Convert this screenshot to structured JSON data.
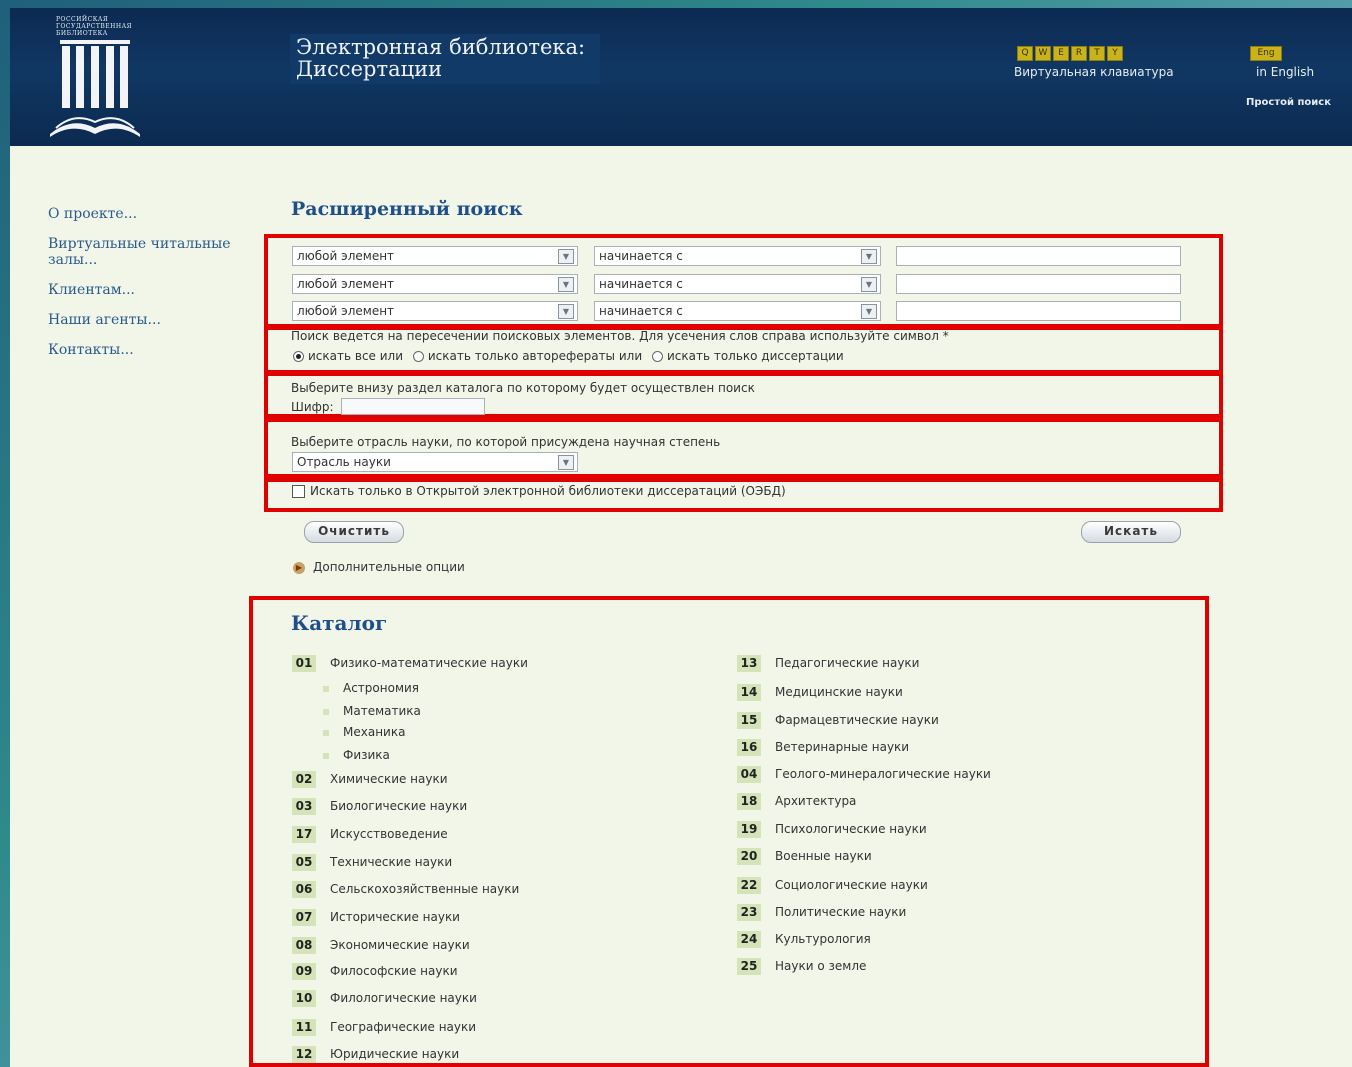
{
  "header": {
    "logo_text": "РОССИЙСКАЯ ГОСУДАРСТВЕННАЯ БИБЛИОТЕКА",
    "title_line1": "Электронная библиотека:",
    "title_line2": "Диссертации",
    "qwerty_keys": [
      "Q",
      "W",
      "E",
      "R",
      "T",
      "Y"
    ],
    "virtual_keyboard": "Виртуальная клавиатура",
    "eng_badge": "Eng",
    "in_english": "in English",
    "simple_search": "Простой поиск"
  },
  "sidebar": {
    "items": [
      {
        "label": "О проекте..."
      },
      {
        "label": "Виртуальные читальные залы..."
      },
      {
        "label": "Клиентам..."
      },
      {
        "label": "Наши агенты..."
      },
      {
        "label": "Контакты..."
      }
    ]
  },
  "search": {
    "title": "Расширенный поиск",
    "rows": [
      {
        "field": "любой элемент",
        "condition": "начинается с",
        "value": ""
      },
      {
        "field": "любой элемент",
        "condition": "начинается с",
        "value": ""
      },
      {
        "field": "любой элемент",
        "condition": "начинается с",
        "value": ""
      }
    ],
    "intersection_note": "Поиск ведется на пересечении поисковых элементов. Для усечения слов справа используйте символ *",
    "radio_options": [
      {
        "label": "искать все или",
        "selected": true
      },
      {
        "label": "искать только авторефераты или",
        "selected": false
      },
      {
        "label": "искать только диссертации",
        "selected": false
      }
    ],
    "catalog_note": "Выберите внизу раздел каталога по которому будет осуществлен поиск",
    "shifr_label": "Шифр:",
    "shifr_value": "",
    "branch_note": "Выберите отрасль науки, по которой присуждена научная степень",
    "branch_select": "Отрасль науки",
    "oebd_label": "Искать только в Открытой электронной библиотеки диссератаций (ОЭБД)",
    "oebd_checked": false,
    "clear_button": "Очистить",
    "search_button": "Искать",
    "additional_options": "Дополнительные опции"
  },
  "catalog": {
    "title": "Каталог",
    "left": [
      {
        "code": "01",
        "name": "Физико-математические науки",
        "subs": [
          "Астрономия",
          "Математика",
          "Механика",
          "Физика"
        ]
      },
      {
        "code": "02",
        "name": "Химические науки"
      },
      {
        "code": "03",
        "name": "Биологические науки"
      },
      {
        "code": "17",
        "name": "Искусствоведение"
      },
      {
        "code": "05",
        "name": "Технические науки"
      },
      {
        "code": "06",
        "name": "Сельскохозяйственные науки"
      },
      {
        "code": "07",
        "name": "Исторические науки"
      },
      {
        "code": "08",
        "name": "Экономические науки"
      },
      {
        "code": "09",
        "name": "Философские науки"
      },
      {
        "code": "10",
        "name": "Филологические науки"
      },
      {
        "code": "11",
        "name": "Географические науки"
      },
      {
        "code": "12",
        "name": "Юридические науки"
      }
    ],
    "right": [
      {
        "code": "13",
        "name": "Педагогические науки"
      },
      {
        "code": "14",
        "name": "Медицинские науки"
      },
      {
        "code": "15",
        "name": "Фармацевтические науки"
      },
      {
        "code": "16",
        "name": "Ветеринарные науки"
      },
      {
        "code": "04",
        "name": "Геолого-минералогические науки"
      },
      {
        "code": "18",
        "name": "Архитектура"
      },
      {
        "code": "19",
        "name": "Психологические науки"
      },
      {
        "code": "20",
        "name": "Военные науки"
      },
      {
        "code": "22",
        "name": "Социологические науки"
      },
      {
        "code": "23",
        "name": "Политические науки"
      },
      {
        "code": "24",
        "name": "Культурология"
      },
      {
        "code": "25",
        "name": "Науки о земле"
      }
    ]
  },
  "colors": {
    "header_bg": "#0c2a52",
    "page_bg": "#f2f6e9",
    "highlight": "#e00000",
    "code_badge": "#d4e3b8",
    "heading": "#1f4f8a"
  }
}
